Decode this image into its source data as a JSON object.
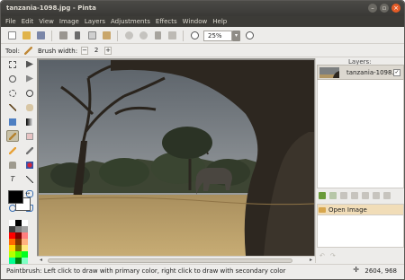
{
  "window": {
    "title": "tanzania-1098.jpg - Pinta"
  },
  "menu": [
    "File",
    "Edit",
    "View",
    "Image",
    "Layers",
    "Adjustments",
    "Effects",
    "Window",
    "Help"
  ],
  "toolbar": {
    "zoom_value": "25%"
  },
  "tool_options": {
    "tool_label": "Tool:",
    "brush_width_label": "Brush width:",
    "brush_width_value": "2",
    "minus": "−",
    "plus": "+"
  },
  "layers": {
    "title": "Layers:",
    "items": [
      {
        "name": "tanzania-1098.j",
        "visible": true
      }
    ]
  },
  "history": {
    "items": [
      {
        "label": "Open Image"
      }
    ]
  },
  "status": {
    "message": "Paintbrush: Left click to draw with primary color, right click to draw with secondary color",
    "coords": "2604, 968"
  },
  "colors": {
    "primary": "#000000",
    "secondary": "#ffffff"
  }
}
